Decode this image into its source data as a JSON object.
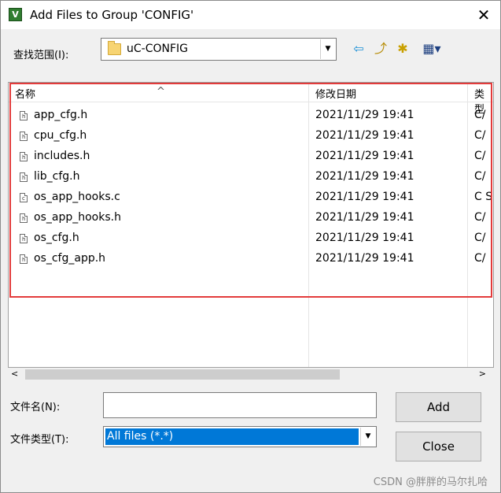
{
  "window": {
    "title": "Add Files to Group 'CONFIG'",
    "app_icon": "uvision-icon",
    "close_glyph": "✕"
  },
  "lookin": {
    "label": "查找范围(I):",
    "value": "uC-CONFIG",
    "arrow": "▼"
  },
  "toolbar": {
    "back_glyph": "⇦",
    "up_glyph": "⤴",
    "new_folder_glyph": "✱",
    "view_glyph": "▦▾"
  },
  "file_list": {
    "columns": [
      "名称",
      "修改日期",
      "类型"
    ],
    "sort_caret": "^",
    "rows": [
      {
        "name": "app_cfg.h",
        "icon": "h",
        "date": "2021/11/29 19:41",
        "type": "C/"
      },
      {
        "name": "cpu_cfg.h",
        "icon": "h",
        "date": "2021/11/29 19:41",
        "type": "C/"
      },
      {
        "name": "includes.h",
        "icon": "h",
        "date": "2021/11/29 19:41",
        "type": "C/"
      },
      {
        "name": "lib_cfg.h",
        "icon": "h",
        "date": "2021/11/29 19:41",
        "type": "C/"
      },
      {
        "name": "os_app_hooks.c",
        "icon": "c",
        "date": "2021/11/29 19:41",
        "type": "C S"
      },
      {
        "name": "os_app_hooks.h",
        "icon": "h",
        "date": "2021/11/29 19:41",
        "type": "C/"
      },
      {
        "name": "os_cfg.h",
        "icon": "h",
        "date": "2021/11/29 19:41",
        "type": "C/"
      },
      {
        "name": "os_cfg_app.h",
        "icon": "h",
        "date": "2021/11/29 19:41",
        "type": "C/"
      }
    ]
  },
  "hscroll": {
    "left_glyph": "<",
    "right_glyph": ">"
  },
  "filename": {
    "label": "文件名(N):",
    "value": ""
  },
  "filetype": {
    "label": "文件类型(T):",
    "value": "All files (*.*)",
    "arrow": "▼"
  },
  "buttons": {
    "add": "Add",
    "close": "Close"
  },
  "watermark": "CSDN @胖胖的马尔扎哈"
}
